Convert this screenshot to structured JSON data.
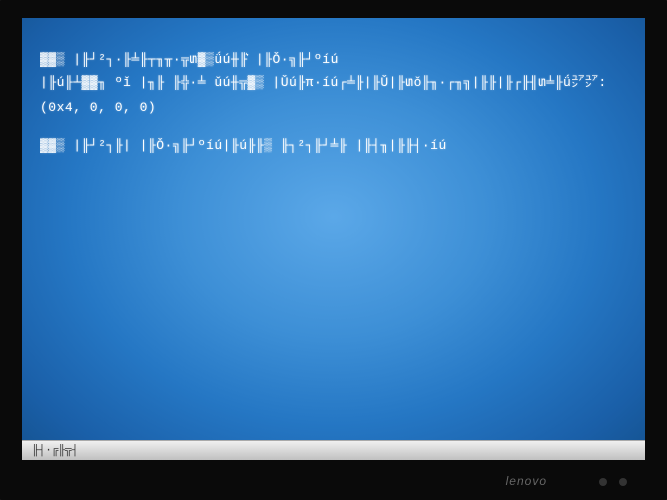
{
  "error_screen": {
    "line1": "▓▓▒ |╟┘²┐·╟╧╟┬╖╥·╦տ▓▒ǘú╫╟͛ |╟Ǒ·╗╟┘ºíú",
    "line2": "|╟ú╟┴▓▓╖ ºǐ |╖╟ ╟╬·╧ ǔú╫╦▓▒ |Ǔú╟π·íú┌╧╟|╟Ǔ|╟տǒ╟╖·┌╖╗|╟╟|╟┌╟╢տ╧╟ǘ㍐㍐:",
    "error_code": "(0x4, 0, 0, 0)",
    "line3": "▓▓▒ |╟┘²┐╟| |╟Ǒ·╗╟┘ºíú|╟ú╟╟▒ ╟┐²┐╟┘╧╟ |╟┤╖|╟╟┤·íú",
    "taskbar_text": "╟┤·╔╟╦┤"
  },
  "monitor": {
    "brand": "lenovo"
  }
}
